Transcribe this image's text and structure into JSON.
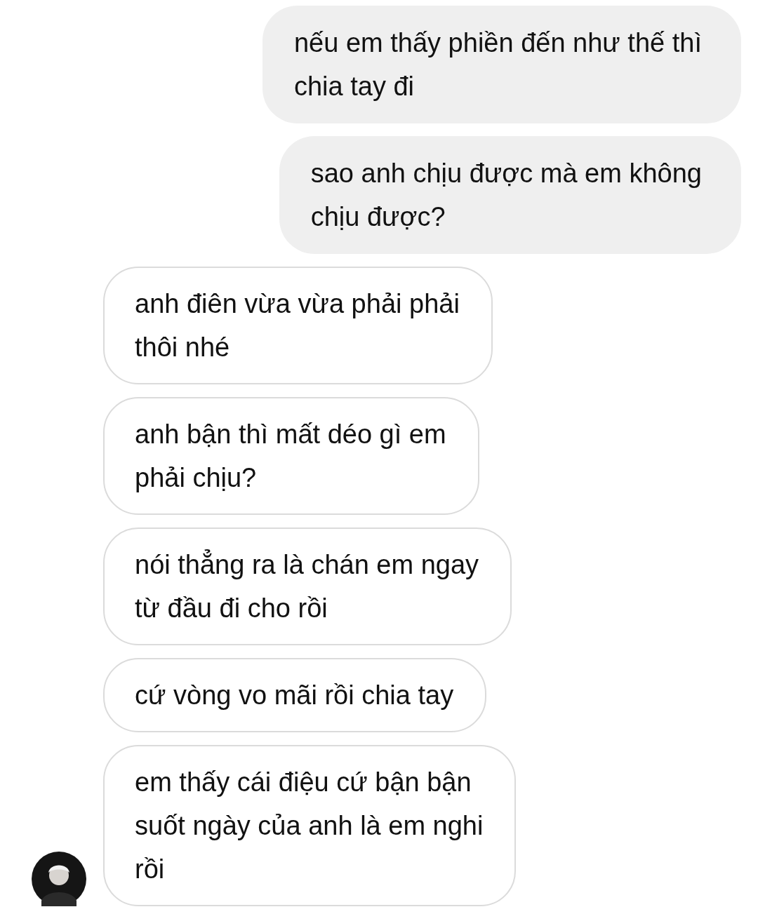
{
  "messages": [
    {
      "kind": "sent",
      "text": "nếu em thấy phiền đến như thế thì\nchia tay đi"
    },
    {
      "kind": "sent",
      "text": "sao anh chịu được mà em không\nchịu được?"
    },
    {
      "kind": "received",
      "text": "anh điên vừa vừa phải phải\nthôi nhé"
    },
    {
      "kind": "received",
      "text": "anh bận thì mất déo gì em\nphải chịu?"
    },
    {
      "kind": "received",
      "text": "nói thẳng ra là chán em ngay\ntừ đầu đi cho rồi"
    },
    {
      "kind": "received",
      "text": "cứ vòng vo mãi rồi chia tay"
    },
    {
      "kind": "received",
      "text": "em thấy cái điệu cứ bận bận\nsuốt ngày của anh là em nghi\nrồi"
    }
  ]
}
